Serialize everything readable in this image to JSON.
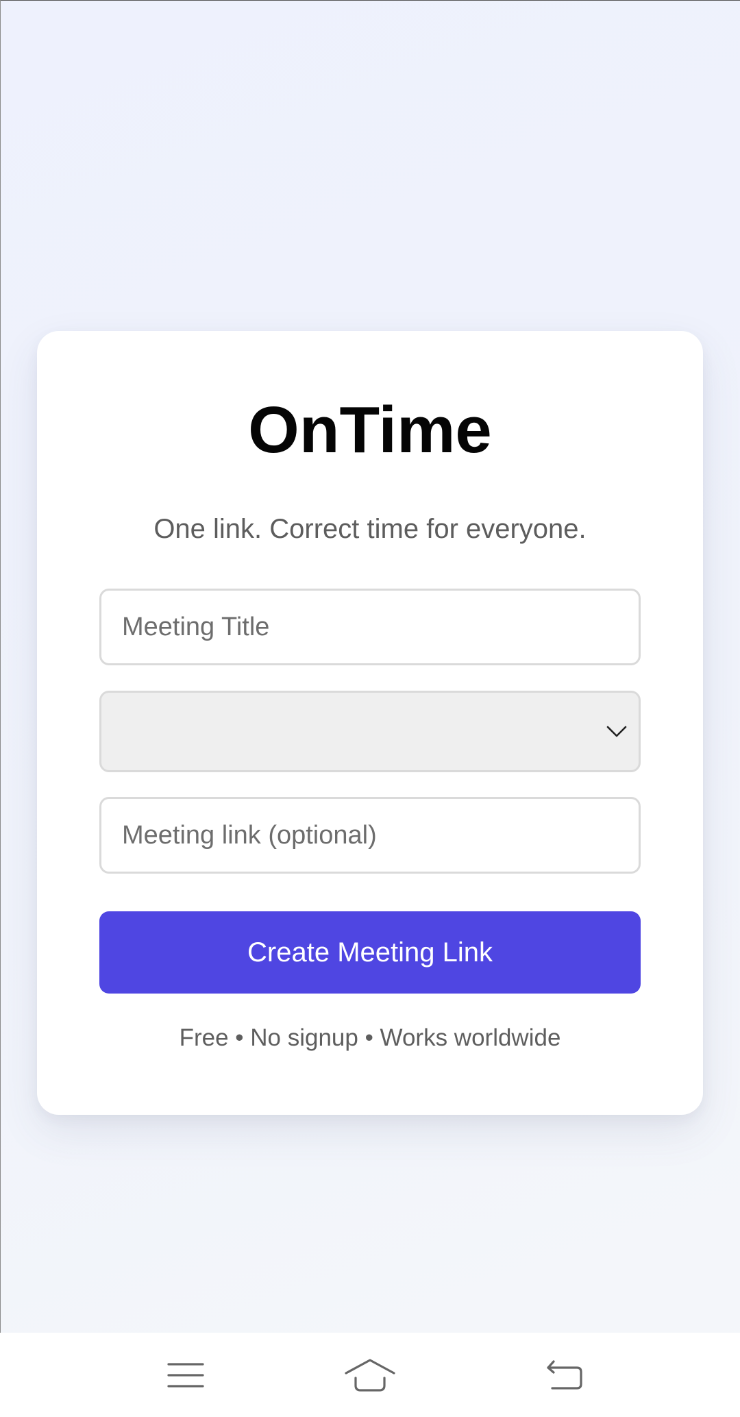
{
  "app": {
    "title": "OnTime",
    "tagline": "One link. Correct time for everyone."
  },
  "form": {
    "meeting_title": {
      "value": "",
      "placeholder": "Meeting Title"
    },
    "timezone_select": {
      "selected": "",
      "icon": "chevron-down-icon"
    },
    "meeting_link": {
      "value": "",
      "placeholder": "Meeting link (optional)"
    },
    "submit_label": "Create Meeting Link",
    "footnote": "Free • No signup • Works worldwide"
  },
  "colors": {
    "accent": "#4f46e2",
    "background": "#eef1fd",
    "card": "#ffffff",
    "select_fill": "#efefef"
  },
  "navbar": {
    "icons": [
      "menu-icon",
      "home-icon",
      "back-icon"
    ]
  }
}
